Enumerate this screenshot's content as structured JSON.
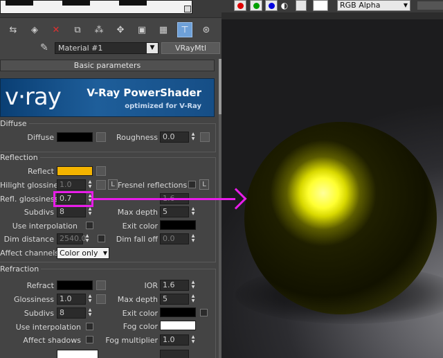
{
  "material_editor": {
    "material_name": "Material #1",
    "material_type": "VRayMtl",
    "rollout_title": "Basic parameters",
    "banner": {
      "logo": "v·ray",
      "title": "V-Ray PowerShader",
      "subtitle": "optimized for V-Ray"
    },
    "diffuse": {
      "group_label": "Diffuse",
      "diffuse_label": "Diffuse",
      "diffuse_color": "#000000",
      "roughness_label": "Roughness",
      "roughness_value": "0.0"
    },
    "reflection": {
      "group_label": "Reflection",
      "reflect_label": "Reflect",
      "reflect_color": "#f4b400",
      "hilight_label": "Hilight glossiness",
      "hilight_value": "1.0",
      "lock_label": "L",
      "fresnel_label": "Fresnel reflections",
      "fresnel_lock_label": "L",
      "refl_gloss_label": "Refl. glossiness",
      "refl_gloss_value": "0.7",
      "fresnel_ior_value": "1.6",
      "subdivs_label": "Subdivs",
      "subdivs_value": "8",
      "max_depth_label": "Max depth",
      "max_depth_value": "5",
      "use_interp_label": "Use interpolation",
      "exit_color_label": "Exit color",
      "exit_color": "#000000",
      "dim_distance_label": "Dim distance",
      "dim_distance_value": "2540.0",
      "dim_falloff_label": "Dim fall off",
      "dim_falloff_value": "0.0",
      "affect_channels_label": "Affect channels",
      "affect_channels_value": "Color only"
    },
    "refraction": {
      "group_label": "Refraction",
      "refract_label": "Refract",
      "refract_color": "#000000",
      "ior_label": "IOR",
      "ior_value": "1.6",
      "glossiness_label": "Glossiness",
      "glossiness_value": "1.0",
      "max_depth_label": "Max depth",
      "max_depth_value": "5",
      "subdivs_label": "Subdivs",
      "subdivs_value": "8",
      "exit_color_label": "Exit color",
      "exit_color": "#000000",
      "use_interp_label": "Use interpolation",
      "fog_color_label": "Fog color",
      "fog_color": "#ffffff",
      "affect_shadows_label": "Affect shadows",
      "fog_multiplier_label": "Fog multiplier",
      "fog_multiplier_value": "1.0"
    }
  },
  "render_window": {
    "channel_select": "RGB Alpha",
    "channel_buttons": [
      "red",
      "green",
      "blue"
    ],
    "channel_colors": {
      "red": "#e00000",
      "green": "#00a000",
      "blue": "#0000e0"
    },
    "accent": "#e81ce8",
    "sphere_color": "#f0f000"
  }
}
